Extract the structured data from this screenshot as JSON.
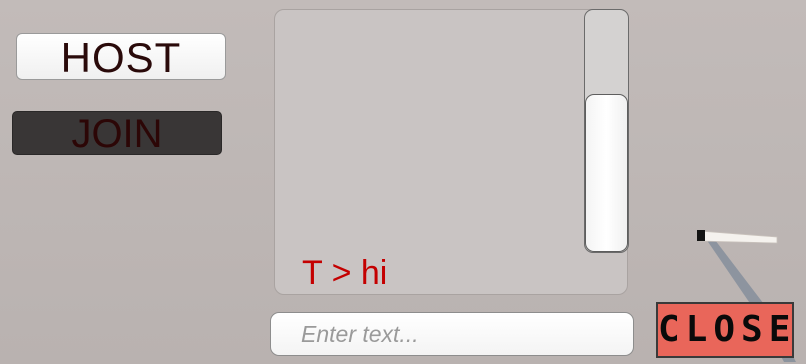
{
  "menu": {
    "host_label": "HOST",
    "join_label": "JOIN"
  },
  "chat": {
    "messages": [
      "T > hi"
    ],
    "scroll_position": 0.35
  },
  "input": {
    "placeholder": "Enter text...",
    "value": ""
  },
  "close_button": {
    "label": "CLOSE"
  },
  "colors": {
    "background": "#bcb4b2",
    "message_text": "#c40000",
    "close_button": "#e9665a",
    "join_button": "#393636"
  }
}
